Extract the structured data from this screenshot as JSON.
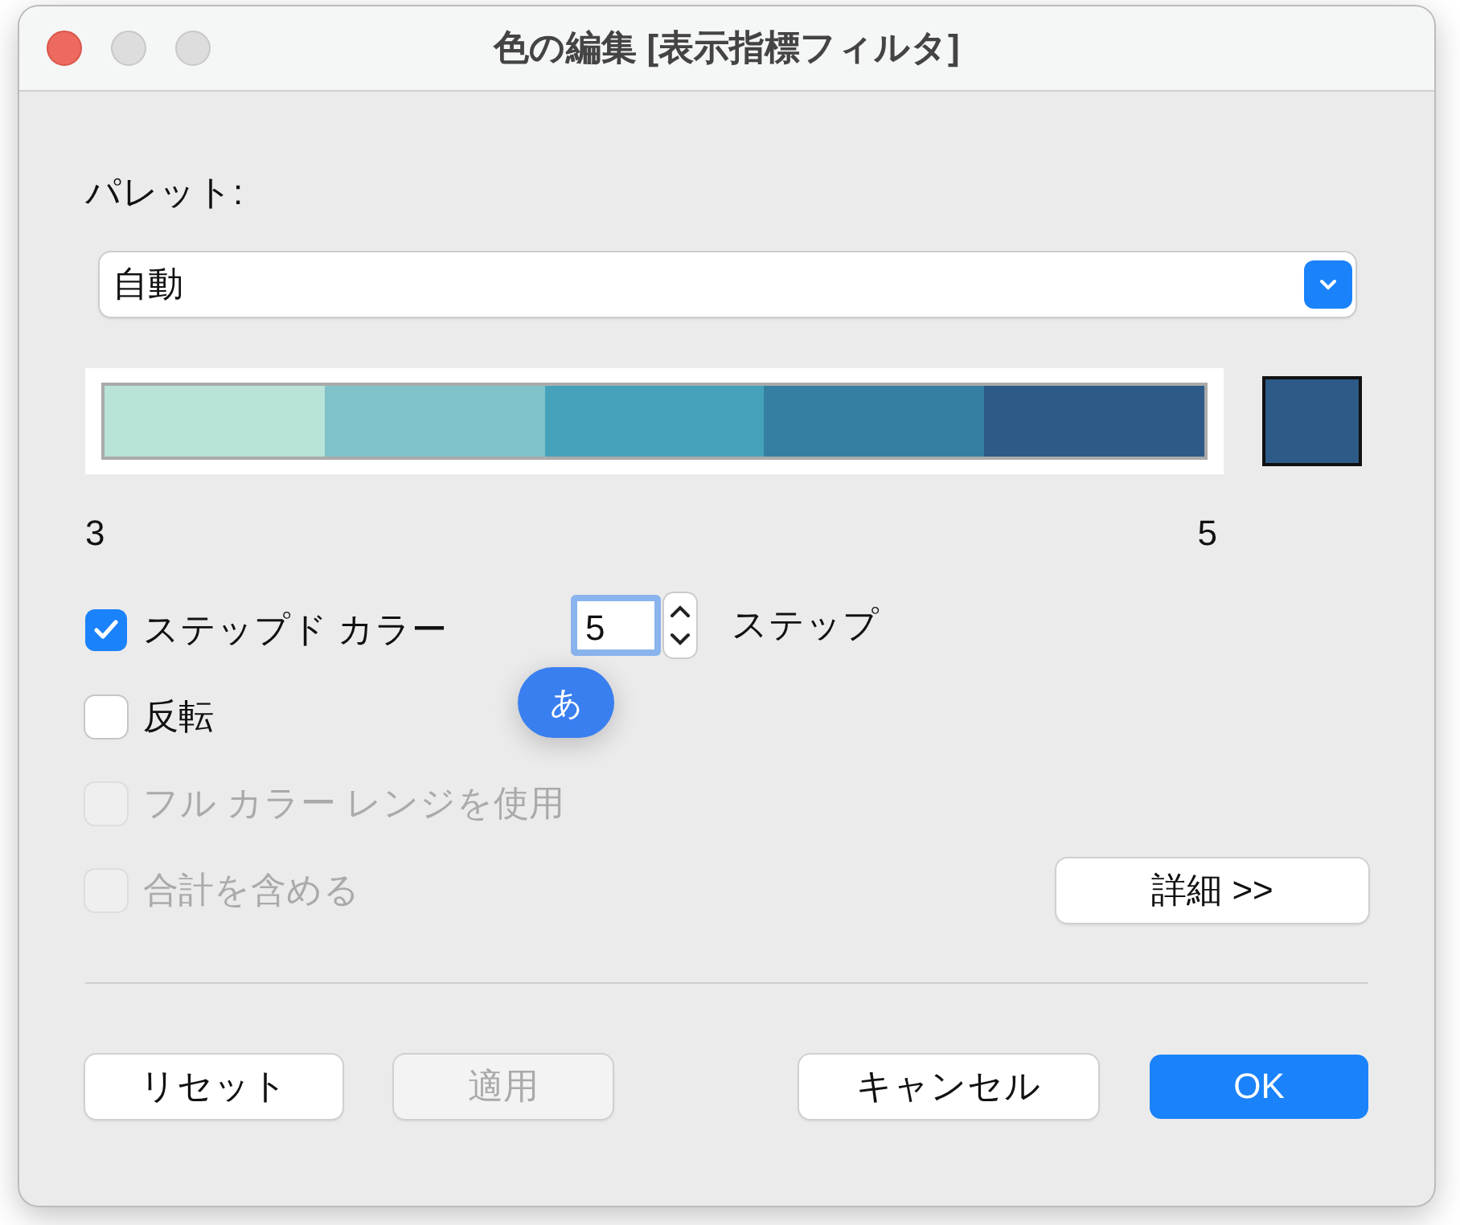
{
  "window": {
    "title": "色の編集 [表示指標フィルタ]"
  },
  "palette": {
    "label": "パレット:",
    "value": "自動"
  },
  "color_ramp": {
    "segments": [
      {
        "color": "#b9e2d8"
      },
      {
        "color": "#7fc2c9"
      },
      {
        "color": "#46a2bb"
      },
      {
        "color": "#347fa2"
      },
      {
        "color": "#2d5a87"
      }
    ],
    "swatch": {
      "color": "#2d5a87"
    },
    "min_label": "3",
    "max_label": "5"
  },
  "options": [
    {
      "label": "ステップド カラー",
      "checked": true,
      "disabled": false
    },
    {
      "label": "反転",
      "checked": false,
      "disabled": false
    },
    {
      "label": "フル カラー レンジを使用",
      "checked": false,
      "disabled": true
    },
    {
      "label": "合計を含める",
      "checked": false,
      "disabled": true
    }
  ],
  "steps": {
    "value": "5",
    "unit": "ステップ"
  },
  "ime_indicator": "あ",
  "details_button": "詳細 >>",
  "buttons": [
    {
      "label": "リセット",
      "disabled": false,
      "primary": false
    },
    {
      "label": "適用",
      "disabled": true,
      "primary": false
    },
    {
      "label": "キャンセル",
      "disabled": false,
      "primary": false
    },
    {
      "label": "OK",
      "disabled": false,
      "primary": true
    }
  ]
}
